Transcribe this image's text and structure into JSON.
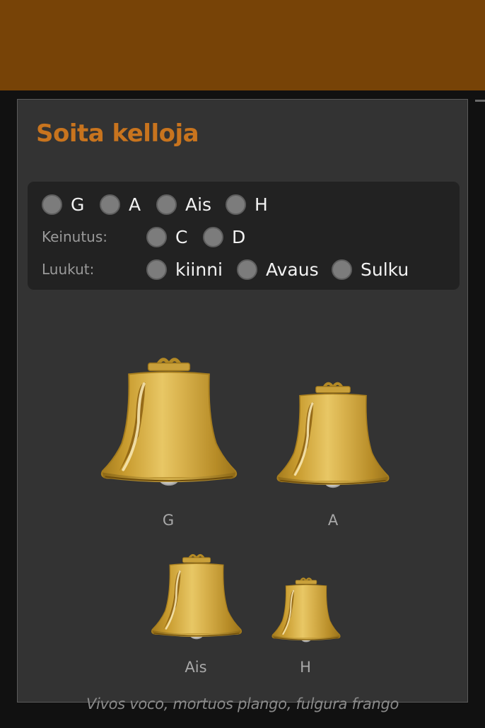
{
  "header": {
    "title": "Soita kelloja"
  },
  "controls": {
    "bells_row": {
      "options": [
        {
          "label": "G"
        },
        {
          "label": "A"
        },
        {
          "label": "Ais"
        },
        {
          "label": "H"
        }
      ]
    },
    "swing_row": {
      "label": "Keinutus:",
      "options": [
        {
          "label": "C"
        },
        {
          "label": "D"
        }
      ]
    },
    "hatches_row": {
      "label": "Luukut:",
      "options": [
        {
          "label": "kiinni"
        },
        {
          "label": "Avaus"
        },
        {
          "label": "Sulku"
        }
      ]
    }
  },
  "bells": [
    {
      "label": "G"
    },
    {
      "label": "A"
    },
    {
      "label": "Ais"
    },
    {
      "label": "H"
    }
  ],
  "footer": {
    "motto": "Vivos voco, mortuos plango, fulgura frango"
  },
  "colors": {
    "topbar": "#774307",
    "accent": "#c8741e",
    "bell_gold": "#d9b24a"
  }
}
